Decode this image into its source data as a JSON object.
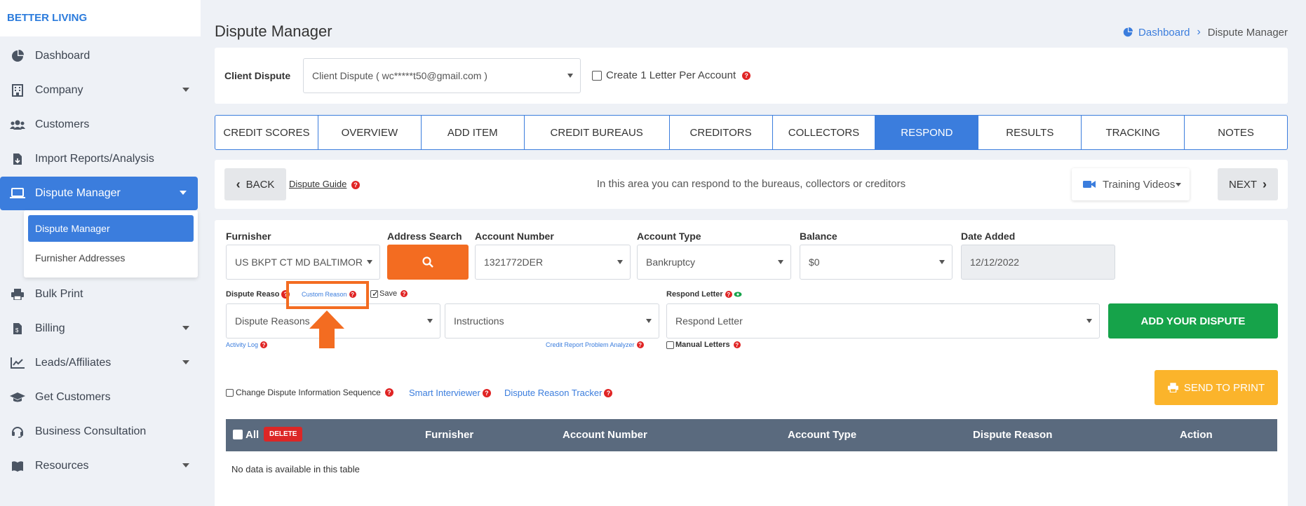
{
  "brand": "BETTER LIVING",
  "sidebar": {
    "items": [
      {
        "label": "Dashboard",
        "icon": "pie-chart-icon"
      },
      {
        "label": "Company",
        "icon": "building-icon"
      },
      {
        "label": "Customers",
        "icon": "users-icon"
      },
      {
        "label": "Import Reports/Analysis",
        "icon": "file-import-icon"
      },
      {
        "label": "Dispute Manager",
        "icon": "laptop-icon"
      },
      {
        "label": "Bulk Print",
        "icon": "printer-icon"
      },
      {
        "label": "Billing",
        "icon": "invoice-icon"
      },
      {
        "label": "Leads/Affiliates",
        "icon": "chart-line-icon"
      },
      {
        "label": "Get Customers",
        "icon": "graduation-cap-icon"
      },
      {
        "label": "Business Consultation",
        "icon": "headset-icon"
      },
      {
        "label": "Resources",
        "icon": "book-icon"
      }
    ],
    "submenu": [
      "Dispute Manager",
      "Furnisher Addresses"
    ]
  },
  "header": {
    "title": "Dispute Manager",
    "breadcrumb": {
      "home": "Dashboard",
      "current": "Dispute Manager"
    }
  },
  "client": {
    "label": "Client Dispute",
    "select_value": "Client Dispute ( wc*****t50@gmail.com )",
    "checkbox_label": "Create 1 Letter Per Account"
  },
  "tabs": [
    {
      "label": "CREDIT SCORES"
    },
    {
      "label": "OVERVIEW"
    },
    {
      "label": "ADD ITEM"
    },
    {
      "label": "CREDIT BUREAUS"
    },
    {
      "label": "CREDITORS"
    },
    {
      "label": "COLLECTORS"
    },
    {
      "label": "RESPOND"
    },
    {
      "label": "RESULTS"
    },
    {
      "label": "TRACKING"
    },
    {
      "label": "NOTES"
    }
  ],
  "navbar": {
    "back": "BACK",
    "guide": "Dispute Guide",
    "message": "In this area you can respond to the bureaus, collectors or creditors",
    "training": "Training Videos",
    "next": "NEXT"
  },
  "form": {
    "furnisher_label": "Furnisher",
    "furnisher_value": "US BKPT CT MD BALTIMOR",
    "address_search_label": "Address Search",
    "account_number_label": "Account Number",
    "account_number_value": "1321772DER",
    "account_type_label": "Account Type",
    "account_type_value": "Bankruptcy",
    "balance_label": "Balance",
    "balance_value": "$0",
    "date_added_label": "Date Added",
    "date_added_value": "12/12/2022",
    "dispute_reason_label": "Dispute Reaso",
    "custom_reason": "Custom Reason",
    "save_label": "Save",
    "respond_letter_label": "Respond Letter",
    "dispute_reasons_select": "Dispute Reasons",
    "instructions_select": "Instructions",
    "respond_letter_select": "Respond Letter",
    "add_dispute": "ADD YOUR DISPUTE",
    "activity_log": "Activity Log",
    "analyzer": "Credit Report Problem Analyzer",
    "manual_letters": "Manual Letters",
    "change_sequence": "Change Dispute Information Sequence",
    "smart_interviewer": "Smart Interviewer",
    "reason_tracker": "Dispute Reason Tracker",
    "send_to_print": "SEND TO PRINT"
  },
  "table": {
    "all": "All",
    "delete": "DELETE",
    "columns": [
      "Furnisher",
      "Account Number",
      "Account Type",
      "Dispute Reason",
      "Action"
    ],
    "empty": "No data is available in this table"
  },
  "colors": {
    "primary": "#3b7ddd",
    "orange": "#f36c21",
    "green": "#16a34a",
    "yellow": "#fbb42b",
    "danger": "#dc2626"
  }
}
